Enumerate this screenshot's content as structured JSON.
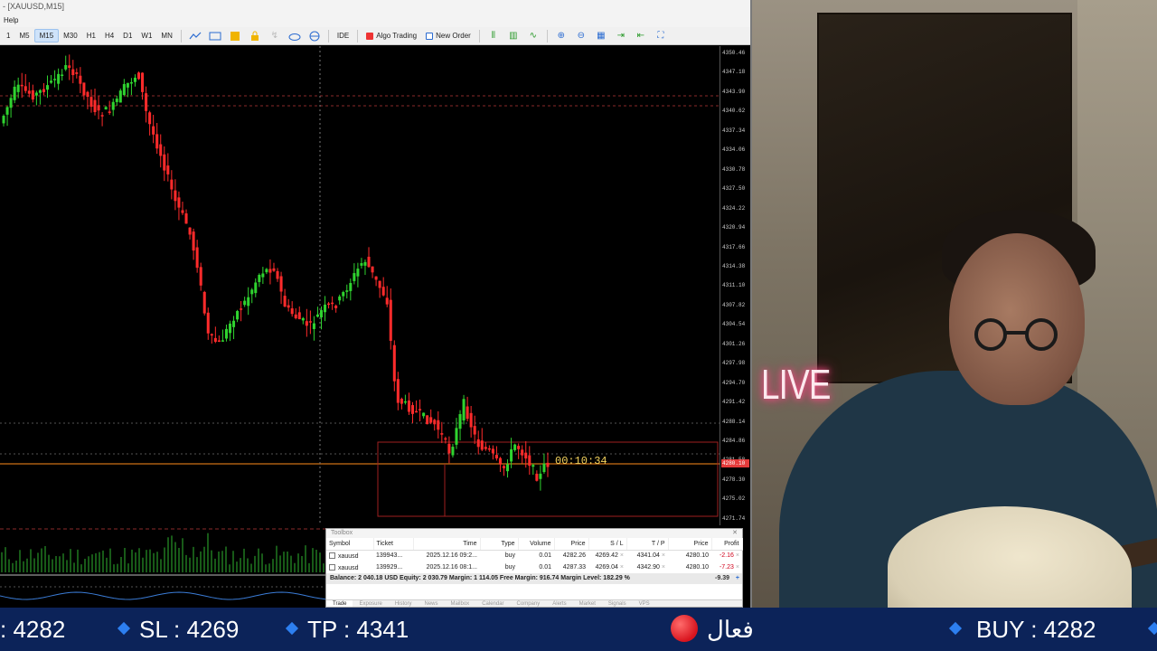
{
  "window": {
    "title": "- [XAUUSD,M15]"
  },
  "menu": {
    "help": "Help"
  },
  "toolbar": {
    "timeframes": [
      "1",
      "M5",
      "M15",
      "M30",
      "H1",
      "H4",
      "D1",
      "W1",
      "MN"
    ],
    "active_timeframe": "M15",
    "ide_label": "IDE",
    "algo_trading_label": "Algo Trading",
    "new_order_label": "New Order"
  },
  "chart": {
    "symbol": "XAUUSD",
    "timeframe": "M15",
    "countdown": "00:10:34",
    "price_ticks": [
      "4350.46",
      "4347.18",
      "4343.90",
      "4340.62",
      "4337.34",
      "4334.06",
      "4330.78",
      "4327.50",
      "4324.22",
      "4320.94",
      "4317.66",
      "4314.38",
      "4311.10",
      "4307.82",
      "4304.54",
      "4301.26",
      "4297.98",
      "4294.70",
      "4291.42",
      "4288.14",
      "4284.86",
      "4281.58",
      "4278.30",
      "4275.02",
      "4271.74"
    ],
    "current_price": "4280.10",
    "colors": {
      "bull": "#2fd32f",
      "bear": "#ff2b2b",
      "bid_line": "#ff8c1a"
    }
  },
  "toolbox": {
    "title": "Toolbox",
    "columns": [
      "Symbol",
      "Ticket",
      "Time",
      "Type",
      "Volume",
      "Price",
      "S / L",
      "T / P",
      "Price",
      "Profit"
    ],
    "rows": [
      [
        "xauusd",
        "139943...",
        "2025.12.16 09:2...",
        "buy",
        "0.01",
        "4282.26",
        "4269.42",
        "4341.04",
        "4280.10",
        "-2.16"
      ],
      [
        "xauusd",
        "139929...",
        "2025.12.16 08:1...",
        "buy",
        "0.01",
        "4287.33",
        "4269.04",
        "4342.90",
        "4280.10",
        "-7.23"
      ]
    ],
    "balance_line": "Balance: 2 040.18 USD  Equity: 2 030.79  Margin: 1 114.05  Free Margin: 916.74  Margin Level: 182.29 %",
    "total_profit": "-9.39",
    "tabs": [
      "Trade",
      "Exposure",
      "History",
      "News",
      "Mailbox",
      "Calendar",
      "Company",
      "Alerts",
      "Market",
      "Signals",
      "VPS"
    ]
  },
  "webcam": {
    "sign_text": "LIVE"
  },
  "ticker": {
    "items": [
      ": 4282",
      "SL : 4269",
      "TP :  4341",
      "فعال",
      "BUY : 4282"
    ],
    "colors": {
      "background": "#0c2359",
      "diamond": "#2d7ff0",
      "dot": "#e01a22"
    }
  }
}
